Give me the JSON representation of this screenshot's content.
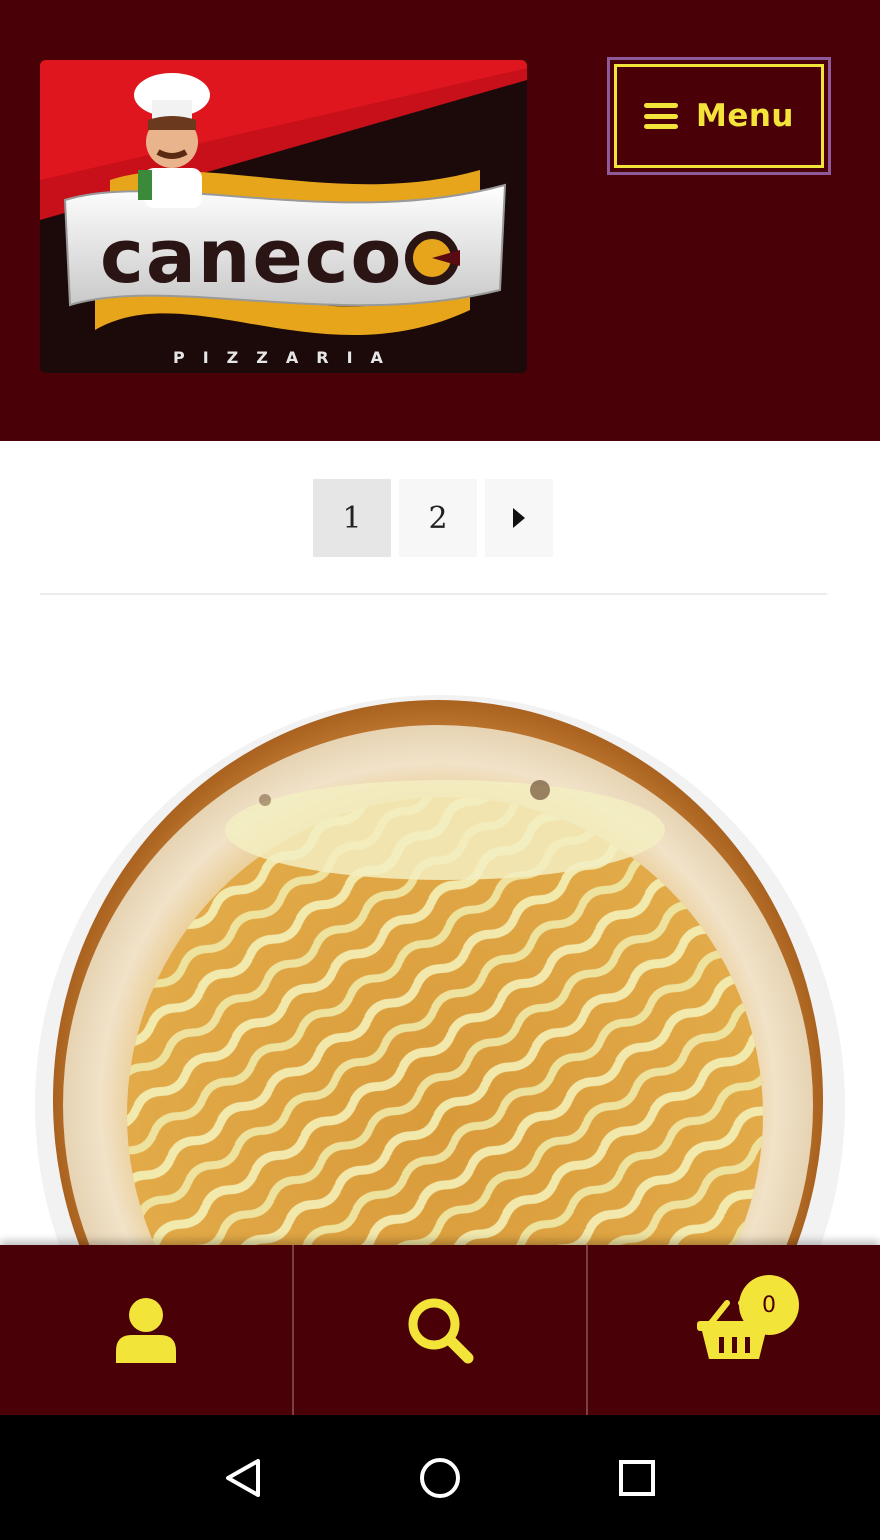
{
  "header": {
    "logo": {
      "brand_name": "caneco",
      "tagline": "PIZZARIA"
    },
    "menu_button": {
      "label": "Menu",
      "icon": "hamburger-icon"
    }
  },
  "pagination": {
    "pages": [
      "1",
      "2"
    ],
    "current_page": "1",
    "next_icon": "triangle-right-icon"
  },
  "product": {
    "image_icon": "pizza-image"
  },
  "bottom_nav": {
    "account_icon": "user-icon",
    "search_icon": "search-icon",
    "cart_icon": "basket-icon",
    "cart_count": "0"
  },
  "system_bar": {
    "back_icon": "back-triangle-icon",
    "home_icon": "home-circle-icon",
    "recents_icon": "recents-square-icon"
  },
  "colors": {
    "header_bg": "#4a0007",
    "accent_yellow": "#f3e43a",
    "menu_outline": "#8e5a9a",
    "page_bg": "#ffffff"
  }
}
